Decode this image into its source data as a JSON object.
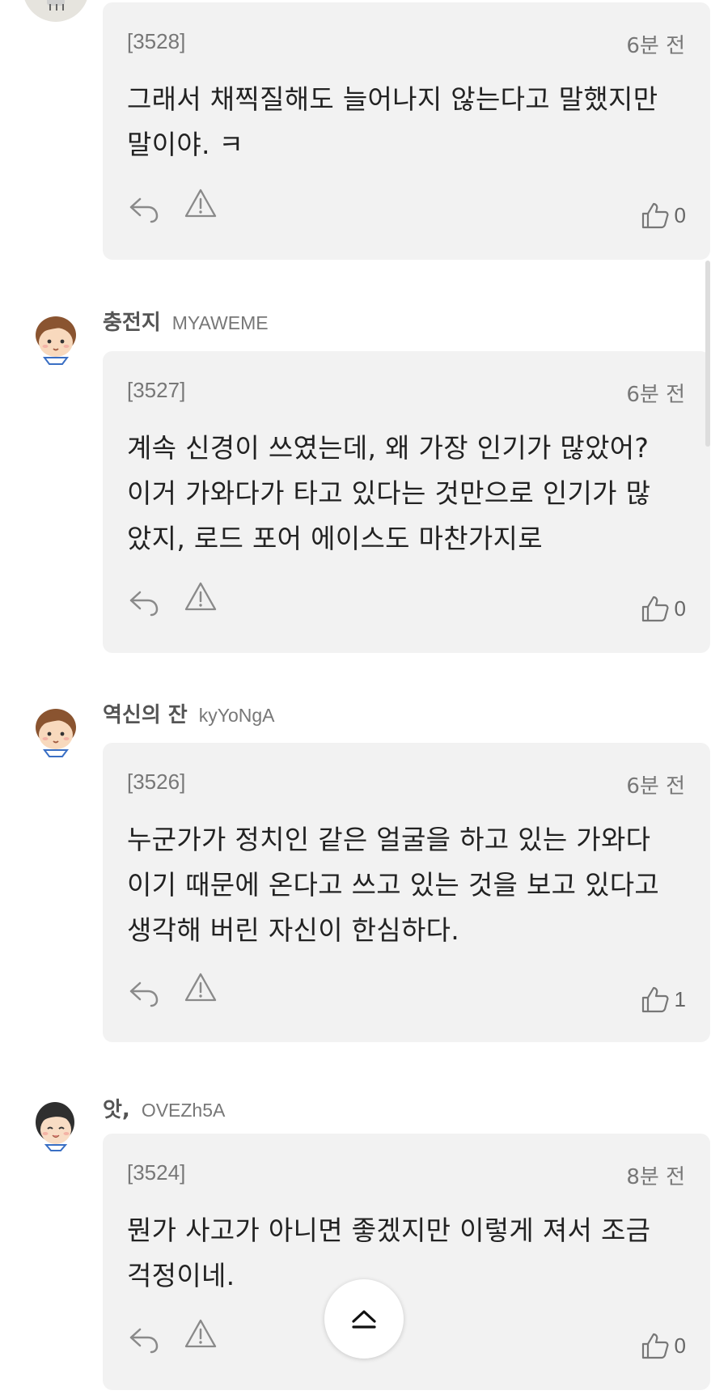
{
  "comments": [
    {
      "author_name": "",
      "author_id": "",
      "number": "[3528]",
      "time": "6분 전",
      "text": "그래서 채찍질해도 늘어나지 않는다고 말했지만\n말이야. ㅋ",
      "likes": "0"
    },
    {
      "author_name": "충전지",
      "author_id": "MYAWEME",
      "number": "[3527]",
      "time": "6분 전",
      "text": "계속 신경이 쓰였는데, 왜 가장 인기가 많았어?\n이거 가와다가 타고 있다는 것만으로 인기가 많\n았지, 로드 포어 에이스도 마찬가지로",
      "likes": "0"
    },
    {
      "author_name": "역신의 잔",
      "author_id": "kyYoNgA",
      "number": "[3526]",
      "time": "6분 전",
      "text": "누군가가 정치인 같은 얼굴을 하고 있는 가와다\n이기 때문에 온다고 쓰고 있는 것을 보고 있다고\n생각해 버린 자신이 한심하다.",
      "likes": "1"
    },
    {
      "author_name": "앗,",
      "author_id": "OVEZh5A",
      "number": "[3524]",
      "time": "8분 전",
      "text": "뭔가 사고가 아니면 좋겠지만 이렇게 져서 조금\n걱정이네.",
      "likes": "0"
    }
  ],
  "icons": {
    "reply": "reply-arrow-icon",
    "report": "warning-triangle-icon",
    "like": "thumbs-up-icon",
    "top": "chevron-up-icon"
  },
  "colors": {
    "card_bg": "#f2f2f2",
    "icon_gray": "#8a8a8a",
    "text": "#222222",
    "meta": "#777777"
  }
}
